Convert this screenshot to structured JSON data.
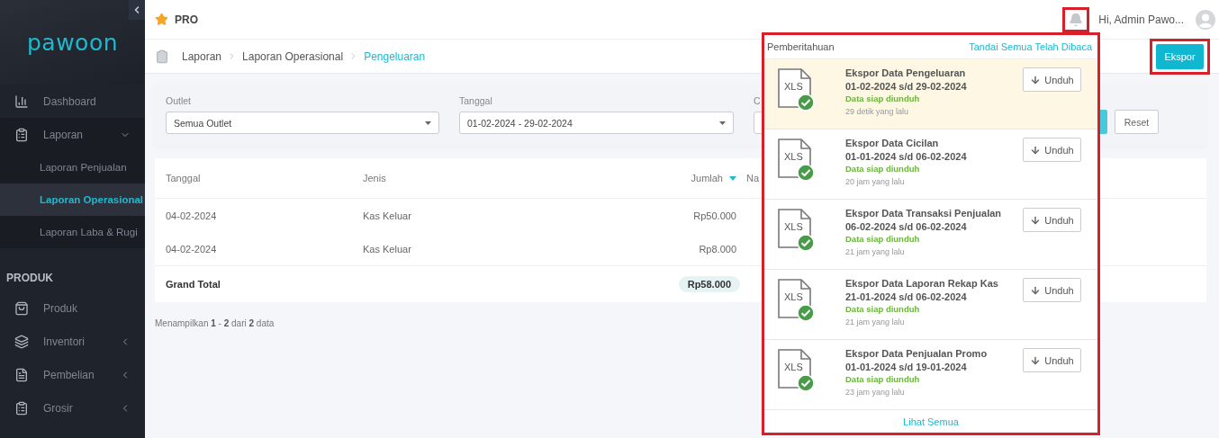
{
  "sidebar": {
    "logo": "pawoon",
    "items": [
      {
        "label": "Dashboard"
      },
      {
        "label": "Laporan",
        "expanded": true,
        "children": [
          {
            "label": "Laporan Penjualan",
            "selected": false
          },
          {
            "label": "Laporan Operasional",
            "selected": true
          },
          {
            "label": "Laporan Laba & Rugi",
            "selected": false
          }
        ]
      }
    ],
    "sections": [
      {
        "title": "PRODUK",
        "items": [
          {
            "label": "Produk"
          },
          {
            "label": "Inventori",
            "expanded": false
          },
          {
            "label": "Pembelian",
            "expanded": false
          },
          {
            "label": "Grosir",
            "expanded": false
          }
        ]
      }
    ]
  },
  "header": {
    "plan": "PRO",
    "greeting": "Hi, Admin Pawo...",
    "bell_highlighted": true
  },
  "breadcrumb": [
    {
      "label": "Laporan",
      "selected": false
    },
    {
      "label": "Laporan Operasional",
      "selected": false
    },
    {
      "label": "Pengeluaran",
      "selected": true
    }
  ],
  "export_button": {
    "label": "Ekspor",
    "highlighted": true
  },
  "filters": [
    {
      "label": "Outlet",
      "value": "Semua Outlet"
    },
    {
      "label": "Tanggal",
      "value": "01-02-2024 - 29-02-2024"
    },
    {
      "label": "C"
    }
  ],
  "reset_button": "Reset",
  "table": {
    "columns": [
      {
        "label": "Tanggal",
        "sorted": false
      },
      {
        "label": "Jenis",
        "sorted": false
      },
      {
        "label": "Jumlah",
        "sorted": true
      },
      {
        "label": "Na"
      }
    ],
    "rows": [
      [
        "04-02-2024",
        "Kas Keluar",
        "Rp50.000"
      ],
      [
        "04-02-2024",
        "Kas Keluar",
        "Rp8.000"
      ]
    ],
    "total": {
      "label": "Grand Total",
      "value": "Rp58.000"
    }
  },
  "pagination": "Menampilkan **1** - **2** dari **2** data",
  "notifications": {
    "title": "Pemberitahuan",
    "mark_all": "Tandai Semua Telah Dibaca",
    "highlighted": true,
    "items": [
      {
        "file_type": "XLS",
        "title": "Ekspor Data Pengeluaran",
        "range": "01-02-2024 s/d 29-02-2024",
        "status": "Data siap diunduh",
        "time": "29 detik yang lalu",
        "read": false,
        "action": "Unduh"
      },
      {
        "file_type": "XLS",
        "title": "Ekspor Data Cicilan",
        "range": "01-01-2024 s/d 06-02-2024",
        "status": "Data siap diunduh",
        "time": "20 jam yang lalu",
        "read": true,
        "action": "Unduh"
      },
      {
        "file_type": "XLS",
        "title": "Ekspor Data Transaksi Penjualan",
        "range": "06-02-2024 s/d 06-02-2024",
        "status": "Data siap diunduh",
        "time": "21 jam yang lalu",
        "read": true,
        "action": "Unduh"
      },
      {
        "file_type": "XLS",
        "title": "Ekspor Data Laporan Rekap Kas",
        "range": "21-01-2024 s/d 06-02-2024",
        "status": "Data siap diunduh",
        "time": "21 jam yang lalu",
        "read": true,
        "action": "Unduh"
      },
      {
        "file_type": "XLS",
        "title": "Ekspor Data Penjualan Promo",
        "range": "01-01-2024 s/d 19-01-2024",
        "status": "Data siap diunduh",
        "time": "23 jam yang lalu",
        "read": true,
        "action": "Unduh"
      }
    ],
    "footer": "Lihat Semua"
  }
}
